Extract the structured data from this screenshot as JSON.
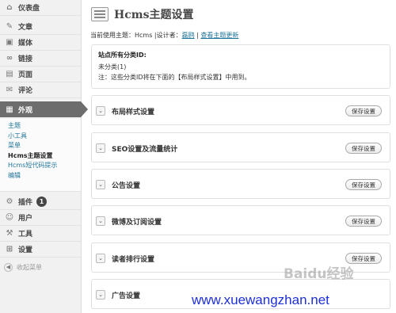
{
  "sidebar": {
    "dashboard": "仪表盘",
    "posts": "文章",
    "media": "媒体",
    "links": "链接",
    "pages": "页面",
    "comments": "评论",
    "appearance": "外观",
    "appearance_sub": [
      "主题",
      "小工具",
      "菜单",
      "Hcms主题设置",
      "Hcms短代码提示",
      "编辑"
    ],
    "plugins": "插件",
    "plugins_badge": "1",
    "users": "用户",
    "tools": "工具",
    "settings": "设置",
    "collapse": "收起菜单"
  },
  "header": {
    "title": "Hcms主题设置",
    "theme_prefix": "当前使用主题：Hcms |设计者：",
    "designer": "磊鸥",
    "sep": " | ",
    "update_link": "查看主题更新"
  },
  "category_box": {
    "title": "站点所有分类ID:",
    "line1": "未分类(1)",
    "line2": "注：这些分类ID将在下面的【布局样式设置】中用到。"
  },
  "panels": [
    {
      "title": "布局样式设置",
      "button": "保存设置"
    },
    {
      "title": "SEO设置及流量统计",
      "button": "保存设置"
    },
    {
      "title": "公告设置",
      "button": "保存设置"
    },
    {
      "title": "微博及订阅设置",
      "button": "保存设置"
    },
    {
      "title": "读者排行设置",
      "button": "保存设置"
    },
    {
      "title": "广告设置",
      "button": ""
    }
  ],
  "watermark": {
    "baidu": "Baidu经验",
    "url": "www.xuewangzhan.net"
  },
  "colors": {
    "link": "#21759b",
    "active_menu": "#6d6d6d",
    "watermark_url": "#1d2fd8"
  },
  "icons": {
    "dashboard": "dashboard-icon",
    "posts": "pin-icon",
    "media": "media-icon",
    "links": "link-icon",
    "pages": "page-icon",
    "comments": "comment-icon",
    "appearance": "appearance-icon",
    "plugins": "plugin-icon",
    "users": "users-icon",
    "tools": "tools-icon",
    "settings": "settings-icon",
    "collapse": "collapse-icon"
  }
}
